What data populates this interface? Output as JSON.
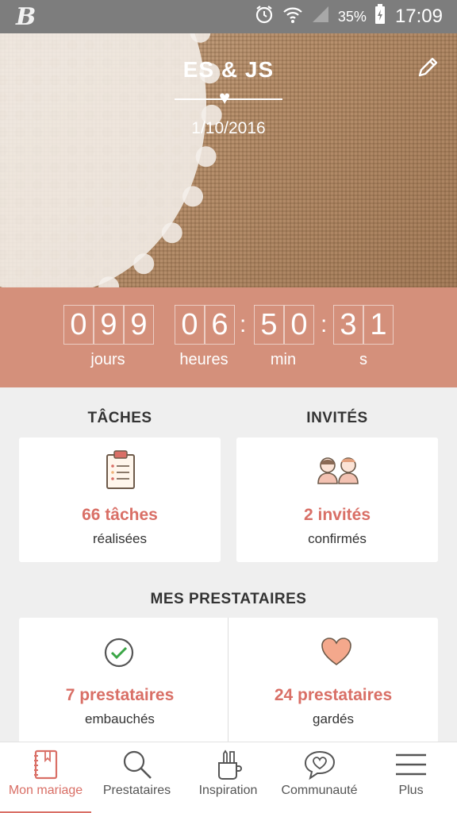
{
  "status_bar": {
    "battery": "35%",
    "time": "17:09",
    "app_logo": "B"
  },
  "hero": {
    "title": "ES & JS",
    "date": "1/10/2016",
    "edit_icon": "pencil-icon"
  },
  "countdown": {
    "days": [
      "0",
      "9",
      "9"
    ],
    "hours": [
      "0",
      "6"
    ],
    "minutes": [
      "5",
      "0"
    ],
    "seconds": [
      "3",
      "1"
    ],
    "labels": {
      "days": "jours",
      "hours": "heures",
      "minutes": "min",
      "seconds": "s"
    }
  },
  "tasks": {
    "heading": "TÂCHES",
    "value": "66 tâches",
    "sub": "réalisées"
  },
  "guests": {
    "heading": "INVITÉS",
    "value": "2 invités",
    "sub": "confirmés"
  },
  "vendors": {
    "heading": "MES PRESTATAIRES",
    "hired": {
      "value": "7 prestataires",
      "sub": "embauchés"
    },
    "saved": {
      "value": "24 prestataires",
      "sub": "gardés"
    }
  },
  "nav": {
    "items": [
      {
        "label": "Mon mariage",
        "icon": "notebook-icon",
        "active": true
      },
      {
        "label": "Prestataires",
        "icon": "search-icon"
      },
      {
        "label": "Inspiration",
        "icon": "pencil-cup-icon"
      },
      {
        "label": "Communauté",
        "icon": "chat-heart-icon"
      },
      {
        "label": "Plus",
        "icon": "menu-icon"
      }
    ]
  },
  "colors": {
    "accent": "#d96f66",
    "countdown_bg": "#d4907b",
    "status_bar": "#7d7d7d"
  }
}
